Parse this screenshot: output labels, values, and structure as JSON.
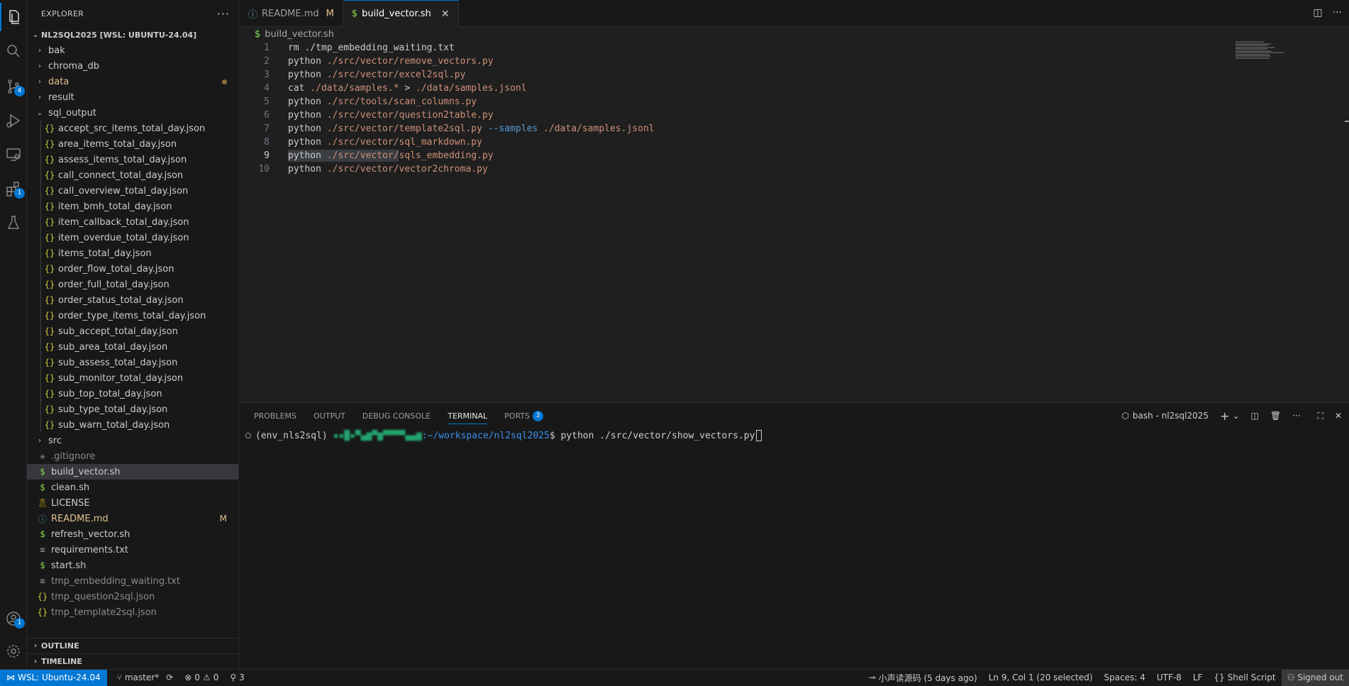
{
  "explorer": {
    "title": "EXPLORER",
    "root": "NL2SQL2025 [WSL: UBUNTU-24.04]",
    "folders_top": [
      {
        "name": "bak",
        "chevron": ">"
      },
      {
        "name": "chroma_db",
        "chevron": ">"
      },
      {
        "name": "data",
        "chevron": ">",
        "modified_dot": true
      },
      {
        "name": "result",
        "chevron": ">"
      },
      {
        "name": "sql_output",
        "chevron": "v"
      }
    ],
    "sql_output_files": [
      "accept_src_items_total_day.json",
      "area_items_total_day.json",
      "assess_items_total_day.json",
      "call_connect_total_day.json",
      "call_overview_total_day.json",
      "item_bmh_total_day.json",
      "item_callback_total_day.json",
      "item_overdue_total_day.json",
      "items_total_day.json",
      "order_flow_total_day.json",
      "order_full_total_day.json",
      "order_status_total_day.json",
      "order_type_items_total_day.json",
      "sub_accept_total_day.json",
      "sub_area_total_day.json",
      "sub_assess_total_day.json",
      "sub_monitor_total_day.json",
      "sub_top_total_day.json",
      "sub_type_total_day.json",
      "sub_warn_total_day.json"
    ],
    "json_icon": "{}",
    "src_folder": "src",
    "root_files": [
      {
        "name": ".gitignore",
        "icon": "◈",
        "kind": "git"
      },
      {
        "name": "build_vector.sh",
        "icon": "$",
        "kind": "sh",
        "selected": true
      },
      {
        "name": "clean.sh",
        "icon": "$",
        "kind": "sh"
      },
      {
        "name": "LICENSE",
        "icon": "🎗",
        "kind": "lic"
      },
      {
        "name": "README.md",
        "icon": "ⓘ",
        "kind": "md",
        "modified": "M"
      },
      {
        "name": "refresh_vector.sh",
        "icon": "$",
        "kind": "sh"
      },
      {
        "name": "requirements.txt",
        "icon": "≡",
        "kind": "txt"
      },
      {
        "name": "start.sh",
        "icon": "$",
        "kind": "sh"
      },
      {
        "name": "tmp_embedding_waiting.txt",
        "icon": "≡",
        "kind": "txt"
      },
      {
        "name": "tmp_question2sql.json",
        "icon": "{}",
        "kind": "json"
      },
      {
        "name": "tmp_template2sql.json",
        "icon": "{}",
        "kind": "json"
      }
    ],
    "outline": "OUTLINE",
    "timeline": "TIMELINE"
  },
  "activity_badges": {
    "source_control": "4",
    "extensions": "1",
    "accounts": "1"
  },
  "tabs": [
    {
      "icon": "ⓘ",
      "label": "README.md",
      "flag": "M",
      "active": false
    },
    {
      "icon": "$",
      "label": "build_vector.sh",
      "close": "✕",
      "active": true
    }
  ],
  "breadcrumb": {
    "icon": "$",
    "file": "build_vector.sh"
  },
  "code_lines": [
    {
      "n": "1",
      "cmd": "rm",
      "rest": " ./tmp_embedding_waiting.txt"
    },
    {
      "n": "2",
      "cmd": "python",
      "path": " ./src/vector/remove_vectors.py"
    },
    {
      "n": "3",
      "cmd": "python",
      "path": " ./src/vector/excel2sql.py"
    },
    {
      "n": "4",
      "cmd": "cat",
      "path": " ./data/samples.*",
      "rest": " > ",
      "path2": "./data/samples.jsonl"
    },
    {
      "n": "5",
      "cmd": "python",
      "path": " ./src/tools/scan_columns.py"
    },
    {
      "n": "6",
      "cmd": "python",
      "path": " ./src/vector/question2table.py"
    },
    {
      "n": "7",
      "cmd": "python",
      "path": " ./src/vector/template2sql.py",
      "opt": " --samples",
      "path2": " ./data/samples.jsonl"
    },
    {
      "n": "8",
      "cmd": "python",
      "path": " ./src/vector/sql_markdown.py"
    },
    {
      "n": "9",
      "cmd": "python",
      "path": " ./src/vector/sqls_embedding.py",
      "current": true
    },
    {
      "n": "10",
      "cmd": "python",
      "path": " ./src/vector/vector2chroma.py"
    }
  ],
  "panel": {
    "tabs": [
      "PROBLEMS",
      "OUTPUT",
      "DEBUG CONSOLE",
      "TERMINAL",
      "PORTS"
    ],
    "active": "TERMINAL",
    "ports_badge": "3",
    "terminal_name": "bash - nl2sql2025",
    "prompt_env": "(env_nls2sql)",
    "prompt_host": "▪▪█▪▀▄▆▀▆▀▀▀▀▄▄▆",
    "prompt_path": ":~/workspace/nl2sql2025",
    "prompt_sign": "$",
    "command": " python ./src/vector/show_vectors.py"
  },
  "status": {
    "remote": "WSL: Ubuntu-24.04",
    "branch": "master*",
    "errors": "0",
    "warnings": "0",
    "ports": "3",
    "blame": "小声读源码 (5 days ago)",
    "position": "Ln 9, Col 1 (20 selected)",
    "spaces": "Spaces: 4",
    "encoding": "UTF-8",
    "eol": "LF",
    "language": "Shell Script",
    "account": "Signed out"
  }
}
